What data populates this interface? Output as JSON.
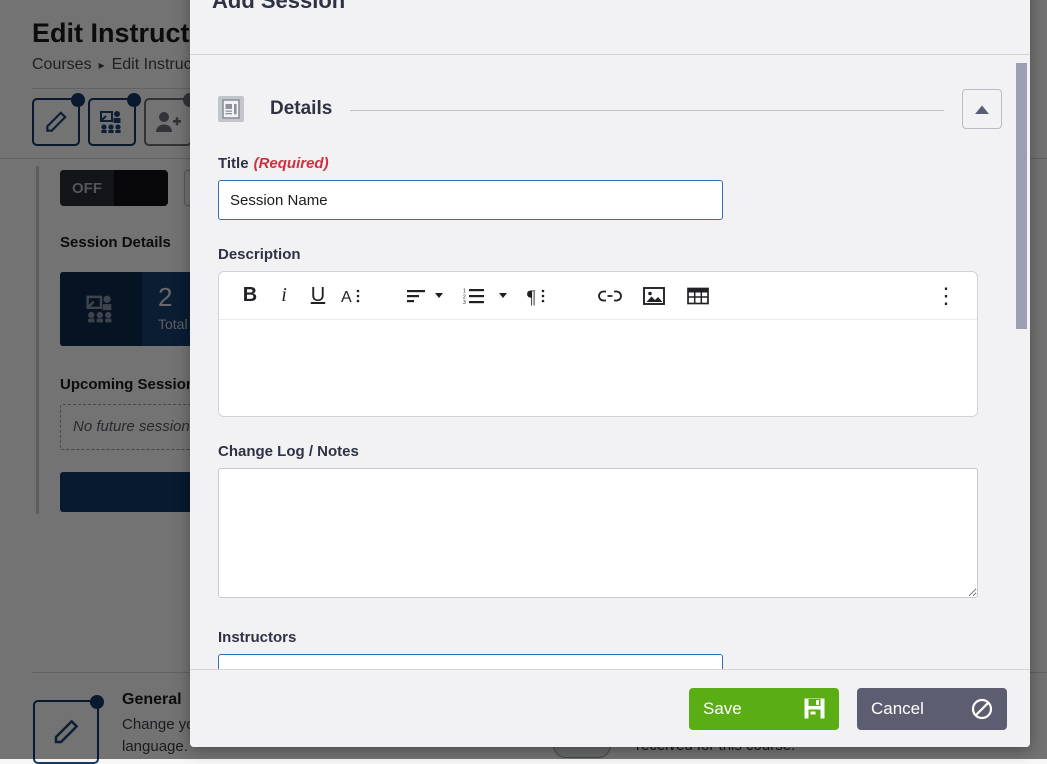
{
  "background": {
    "page_title": "Edit Instructor",
    "breadcrumb": {
      "root": "Courses",
      "separator": "▸",
      "current": "Edit Instructor"
    },
    "toolbar_icons": [
      "pencil-icon",
      "presentation-users-icon",
      "add-user-icon"
    ],
    "toggle": {
      "state_label": "OFF"
    },
    "session_details_heading": "Session Details",
    "stat_card": {
      "value": "2",
      "caption": "Total"
    },
    "upcoming_heading": "Upcoming Sessions",
    "empty_state": "No future sessions",
    "general": {
      "title": "General",
      "text": "Change your default language."
    },
    "right_text": "received for this course."
  },
  "modal": {
    "title": "Add Session",
    "section": {
      "icon": "document-details-icon",
      "label": "Details",
      "collapse_icon": "chevron-up-icon"
    },
    "fields": {
      "title": {
        "label": "Title",
        "required_note": "(Required)",
        "value": "Session Name",
        "placeholder": ""
      },
      "description": {
        "label": "Description",
        "value": "",
        "toolbar": [
          {
            "name": "bold-icon",
            "glyph": "B"
          },
          {
            "name": "italic-icon",
            "glyph": "i"
          },
          {
            "name": "underline-icon",
            "glyph": "U"
          },
          {
            "name": "font-format-icon",
            "glyph": "A"
          },
          {
            "name": "align-icon",
            "glyph": "align"
          },
          {
            "name": "ordered-list-icon",
            "glyph": "list"
          },
          {
            "name": "paragraph-icon",
            "glyph": "¶"
          },
          {
            "name": "link-icon",
            "glyph": "link"
          },
          {
            "name": "image-icon",
            "glyph": "image"
          },
          {
            "name": "table-icon",
            "glyph": "table"
          },
          {
            "name": "more-options-icon",
            "glyph": "⋮"
          }
        ]
      },
      "change_log": {
        "label": "Change Log / Notes",
        "value": "",
        "placeholder": ""
      },
      "instructors": {
        "label": "Instructors"
      }
    },
    "footer": {
      "save_label": "Save",
      "save_icon": "save-floppy-icon",
      "cancel_label": "Cancel",
      "cancel_icon": "cancel-block-icon"
    }
  },
  "colors": {
    "save_green": "#5aad13",
    "cancel_gray": "#5c5d70",
    "accent_blue": "#2f6fb8",
    "required_red": "#d0303e",
    "dark_navy": "#174272"
  }
}
